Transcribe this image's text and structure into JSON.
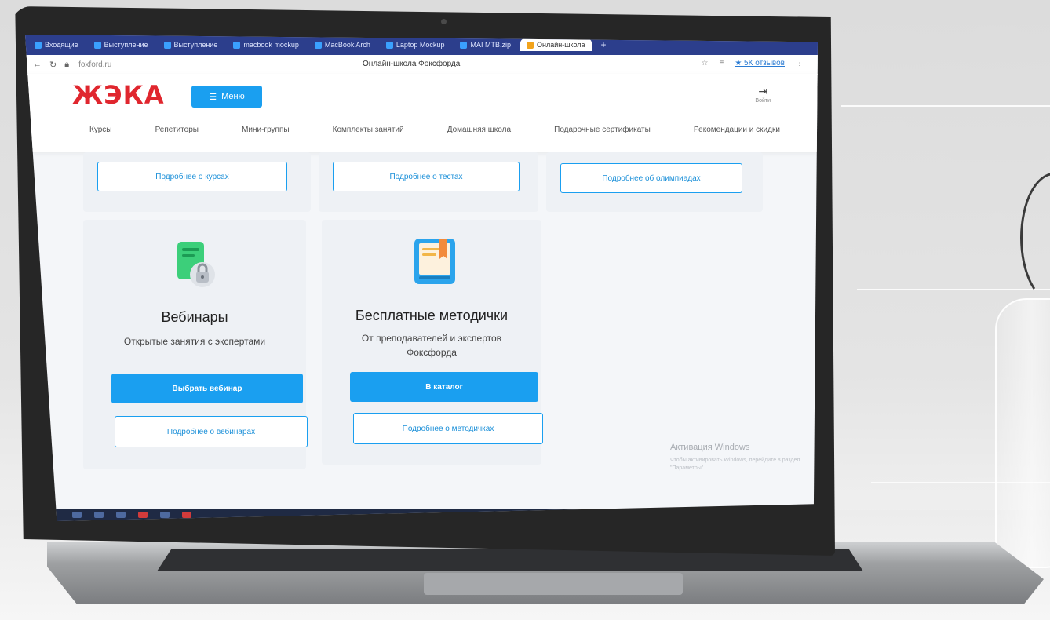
{
  "browser": {
    "tabs": [
      {
        "label": "Входящие"
      },
      {
        "label": "Выступление"
      },
      {
        "label": "Выступление"
      },
      {
        "label": "macbook mockup"
      },
      {
        "label": "MacBook Arch"
      },
      {
        "label": "Laptop Mockup"
      },
      {
        "label": "MAI MTB.zip"
      },
      {
        "label": "Онлайн-школа"
      }
    ],
    "url": "foxford.ru",
    "page_title": "Онлайн-школа Фоксфорда",
    "reviews_label": "★ 5К отзывов"
  },
  "header": {
    "logo": "ЖЭКА",
    "menu_label": "Меню",
    "login_label": "Войти",
    "nav": [
      "Курсы",
      "Репетиторы",
      "Мини-группы",
      "Комплекты занятий",
      "Домашняя школа",
      "Подарочные сертификаты",
      "Рекомендации и скидки"
    ]
  },
  "top_cards": [
    {
      "button": "Подробнее о курсах"
    },
    {
      "button": "Подробнее о тестах"
    },
    {
      "button": "Подробнее об олимпиадах"
    }
  ],
  "cards": [
    {
      "title": "Вебинары",
      "subtitle": "Открытые занятия с экспертами",
      "primary": "Выбрать вебинар",
      "secondary": "Подробнее о вебинарах",
      "icon": "webinar-lock-icon"
    },
    {
      "title": "Бесплатные методички",
      "subtitle": "От преподавателей и экспертов Фоксфорда",
      "primary": "В каталог",
      "secondary": "Подробнее о методичках",
      "icon": "book-bookmark-icon"
    }
  ],
  "watermark": {
    "title": "Активация Windows",
    "text": "Чтобы активировать Windows, перейдите в раздел \"Параметры\"."
  },
  "colors": {
    "accent": "#1a9ff0",
    "logo": "#e0262e",
    "tabbar": "#2c3e8c"
  }
}
